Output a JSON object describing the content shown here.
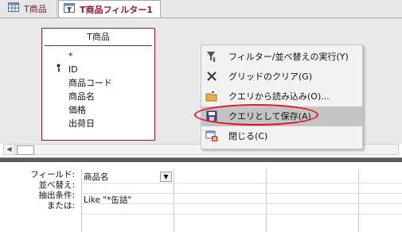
{
  "tabs": [
    {
      "label": "T商品",
      "icon": "table-icon"
    },
    {
      "label": "T商品フィルター1",
      "icon": "filter-design-icon"
    }
  ],
  "table_box": {
    "title": "T商品",
    "fields": [
      "*",
      "ID",
      "商品コード",
      "商品名",
      "価格",
      "出荷日"
    ]
  },
  "context_menu": {
    "items": [
      {
        "label": "フィルター/並べ替えの実行(Y)",
        "icon": "apply-filter-icon"
      },
      {
        "label": "グリッドのクリア(G)",
        "icon": "clear-grid-icon"
      },
      {
        "label": "クエリから読み込み(O)...",
        "icon": "load-from-query-icon"
      },
      {
        "label": "クエリとして保存(A)",
        "icon": "save-icon",
        "highlighted": true
      },
      {
        "label": "閉じる(C)",
        "icon": "close-icon"
      }
    ]
  },
  "grid": {
    "row_labels": [
      "フィールド:",
      "並べ替え:",
      "抽出条件:",
      "または:"
    ],
    "column1": {
      "field": "商品名",
      "criteria": "Like \"*缶詰\""
    }
  },
  "colors": {
    "accent": "#8b1e36",
    "highlight_oval": "#e0141e"
  }
}
